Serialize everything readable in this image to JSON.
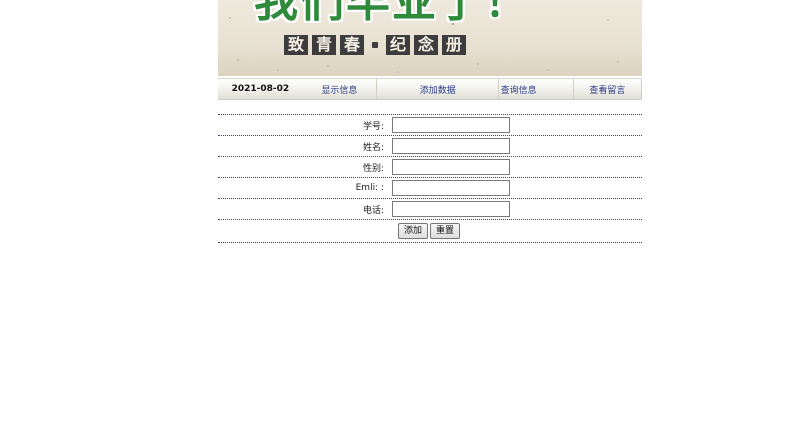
{
  "banner": {
    "slogan": "我们毕业了！",
    "subtitle_chars": [
      "致",
      "青",
      "春",
      "纪",
      "念",
      "册"
    ]
  },
  "nav": {
    "date": "2021-08-02",
    "items": [
      {
        "label": "显示信息"
      },
      {
        "label": "添加数据"
      },
      {
        "label": "查询信息"
      },
      {
        "label": "查看留言"
      }
    ]
  },
  "form": {
    "fields": [
      {
        "label": "学号:",
        "value": ""
      },
      {
        "label": "姓名:",
        "value": ""
      },
      {
        "label": "性别:",
        "value": ""
      },
      {
        "label": "Emli: :",
        "value": ""
      },
      {
        "label": "电话:",
        "value": ""
      }
    ],
    "submit_label": "添加",
    "reset_label": "重置"
  },
  "colors": {
    "slogan_green": "#2f8a3c",
    "nav_link": "#2b3a8a",
    "row_divider": "#2c4a8c"
  }
}
